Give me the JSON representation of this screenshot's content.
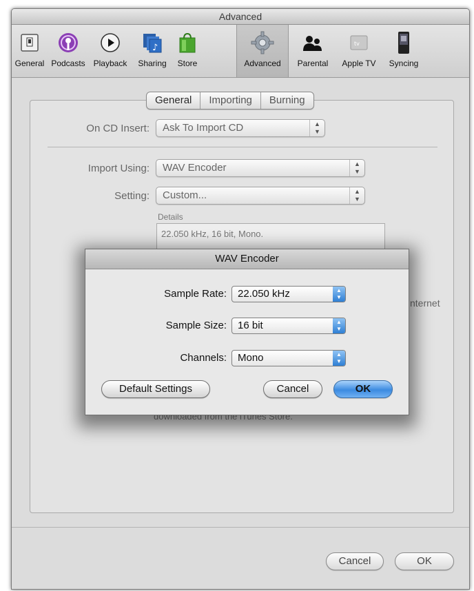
{
  "window": {
    "title": "Advanced"
  },
  "toolbar": {
    "items": [
      {
        "label": "General",
        "icon": "general-switch-icon"
      },
      {
        "label": "Podcasts",
        "icon": "podcasts-icon"
      },
      {
        "label": "Playback",
        "icon": "playback-icon"
      },
      {
        "label": "Sharing",
        "icon": "sharing-icon"
      },
      {
        "label": "Store",
        "icon": "store-bag-icon"
      },
      {
        "label": "Advanced",
        "icon": "gear-icon"
      },
      {
        "label": "Parental",
        "icon": "parental-icon"
      },
      {
        "label": "Apple TV",
        "icon": "apple-tv-icon"
      },
      {
        "label": "Syncing",
        "icon": "ipod-icon"
      }
    ],
    "selected": "Advanced"
  },
  "tabs": [
    {
      "label": "General"
    },
    {
      "label": "Importing"
    },
    {
      "label": "Burning"
    }
  ],
  "selected_tab": "General",
  "form": {
    "on_cd_insert_label": "On CD Insert:",
    "on_cd_insert_value": "Ask To Import CD",
    "import_using_label": "Import Using:",
    "import_using_value": "WAV Encoder",
    "setting_label": "Setting:",
    "setting_value": "Custom...",
    "details_label": "Details",
    "details_text": "22.050 kHz, 16 bit, Mono.",
    "partial_right_text": "nternet",
    "partial_bottom_text": "downloaded from the iTunes Store."
  },
  "footer": {
    "cancel_label": "Cancel",
    "ok_label": "OK"
  },
  "sheet": {
    "title": "WAV Encoder",
    "sample_rate_label": "Sample Rate:",
    "sample_rate_value": "22.050 kHz",
    "sample_size_label": "Sample Size:",
    "sample_size_value": "16 bit",
    "channels_label": "Channels:",
    "channels_value": "Mono",
    "default_settings_label": "Default Settings",
    "cancel_label": "Cancel",
    "ok_label": "OK"
  },
  "colors": {
    "accent_blue": "#3c8be0",
    "window_bg": "#dcdcdc"
  }
}
